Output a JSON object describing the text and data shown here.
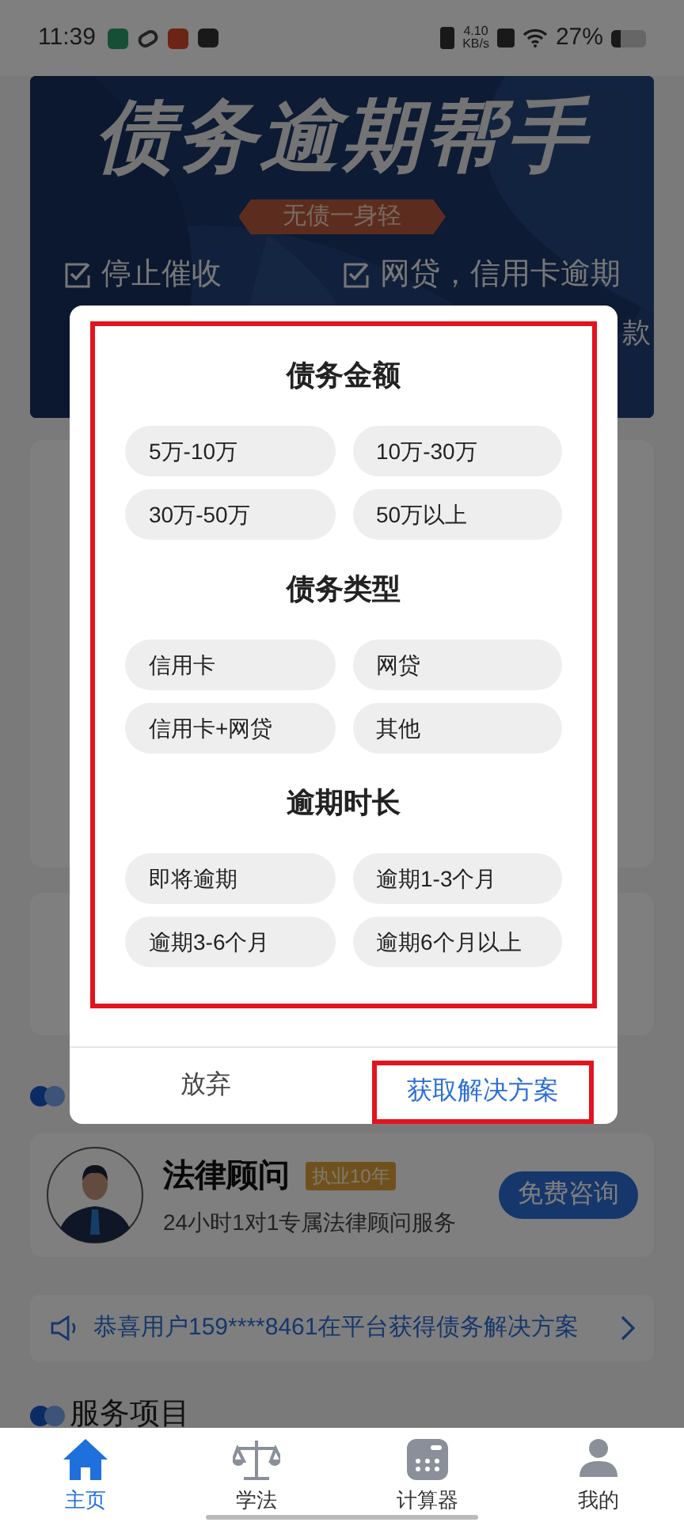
{
  "status_bar": {
    "time": "11:39",
    "net_speed": "4.10",
    "net_unit": "KB/s",
    "battery": "27%"
  },
  "banner": {
    "title": "债务逾期帮手",
    "slogan": "无债一身轻",
    "features": [
      "停止催收",
      "网贷，信用卡逾期",
      "款"
    ]
  },
  "advisor": {
    "name": "法律顾问",
    "badge": "执业10年",
    "description": "24小时1对1专属法律顾问服务",
    "button": "免费咨询"
  },
  "notice": {
    "text": "恭喜用户159****8461在平台获得债务解决方案"
  },
  "services": {
    "title": "服务项目"
  },
  "dialog": {
    "sections": [
      {
        "title": "债务金额",
        "options": [
          {
            "label": "5万-10万",
            "selected": false
          },
          {
            "label": "10万-30万",
            "selected": false
          },
          {
            "label": "30万-50万",
            "selected": false
          },
          {
            "label": "50万以上",
            "selected": false
          }
        ]
      },
      {
        "title": "债务类型",
        "options": [
          {
            "label": "信用卡",
            "selected": false
          },
          {
            "label": "网贷",
            "selected": false
          },
          {
            "label": "信用卡+网贷",
            "selected": false
          },
          {
            "label": "其他",
            "selected": false
          }
        ]
      },
      {
        "title": "逾期时长",
        "options": [
          {
            "label": "即将逾期",
            "selected": false
          },
          {
            "label": "逾期1-3个月",
            "selected": false
          },
          {
            "label": "逾期3-6个月",
            "selected": false
          },
          {
            "label": "逾期6个月以上",
            "selected": false
          }
        ]
      }
    ],
    "cancel": "放弃",
    "confirm": "获取解决方案"
  },
  "tab_bar": [
    {
      "label": "主页",
      "kind": "home",
      "selected": true
    },
    {
      "label": "学法",
      "kind": "scale",
      "selected": false
    },
    {
      "label": "计算器",
      "kind": "calculator",
      "selected": false
    },
    {
      "label": "我的",
      "kind": "person",
      "selected": false
    }
  ]
}
